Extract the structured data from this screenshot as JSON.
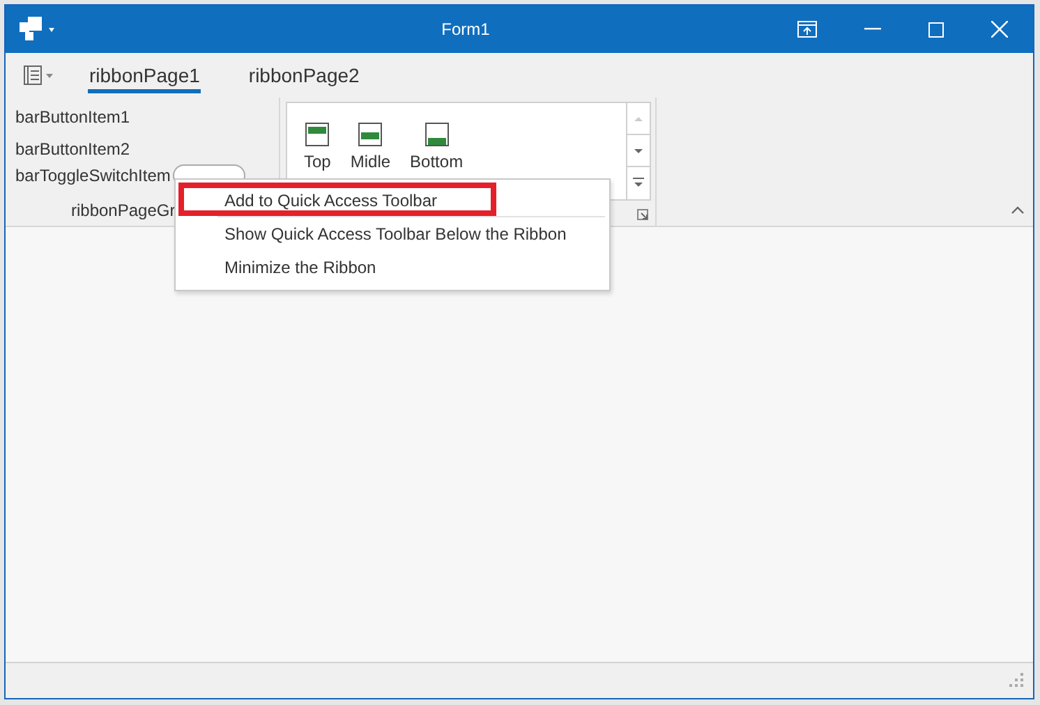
{
  "window": {
    "title": "Form1"
  },
  "tabs": [
    {
      "label": "ribbonPage1",
      "selected": true
    },
    {
      "label": "ribbonPage2",
      "selected": false
    }
  ],
  "group1": {
    "items": [
      {
        "kind": "button",
        "label": "barButtonItem1"
      },
      {
        "kind": "button",
        "label": "barButtonItem2"
      },
      {
        "kind": "toggle",
        "label": "barToggleSwitchItem",
        "on": false
      }
    ],
    "caption": "ribbonPageGr"
  },
  "gallery": {
    "items": [
      {
        "kind": "top",
        "label": "Top"
      },
      {
        "kind": "middle",
        "label": "Midle"
      },
      {
        "kind": "bottom",
        "label": "Bottom"
      }
    ]
  },
  "context_menu": {
    "items": [
      {
        "label": "Add to Quick Access Toolbar",
        "marked": true,
        "separator_after": true
      },
      {
        "label": "Show Quick Access Toolbar Below the Ribbon",
        "marked": false,
        "separator_after": false
      },
      {
        "label": "Minimize the Ribbon",
        "marked": false,
        "separator_after": false
      }
    ]
  }
}
